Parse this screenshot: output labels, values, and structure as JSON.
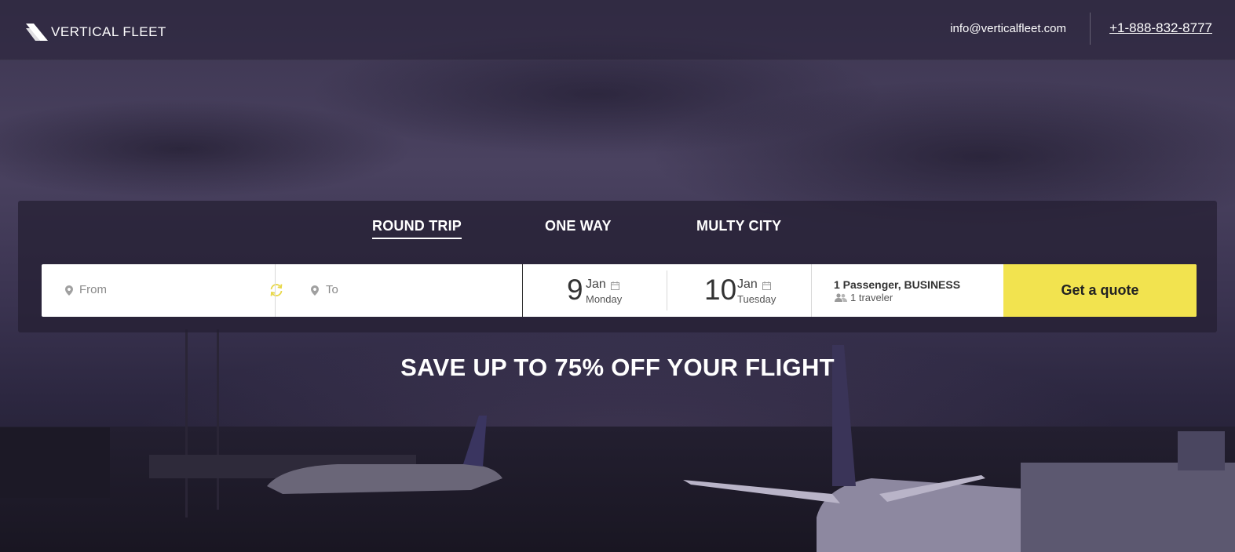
{
  "header": {
    "logo_text": "VERTICAL FLEET",
    "email": "info@verticalfleet.com",
    "phone": "+1-888-832-8777"
  },
  "tabs": [
    {
      "label": "ROUND TRIP",
      "active": true
    },
    {
      "label": "ONE WAY",
      "active": false
    },
    {
      "label": "MULTY CITY",
      "active": false
    }
  ],
  "form": {
    "from_placeholder": "From",
    "to_placeholder": "To",
    "depart": {
      "day": "9",
      "month": "Jan",
      "weekday": "Monday"
    },
    "return": {
      "day": "10",
      "month": "Jan",
      "weekday": "Tuesday"
    },
    "passengers_title": "1 Passenger, BUSINESS",
    "passengers_sub": "1 traveler",
    "submit_label": "Get a quote"
  },
  "headline": "SAVE UP TO 75% OFF YOUR FLIGHT",
  "colors": {
    "accent": "#f2e34f",
    "swap_icon": "#e8d84a",
    "overlay": "#2b2540"
  },
  "icons": {
    "logo": "vertical-fleet-logo-icon",
    "location": "map-pin-icon",
    "swap": "swap-arrows-icon",
    "calendar": "calendar-icon",
    "travelers": "people-icon"
  }
}
